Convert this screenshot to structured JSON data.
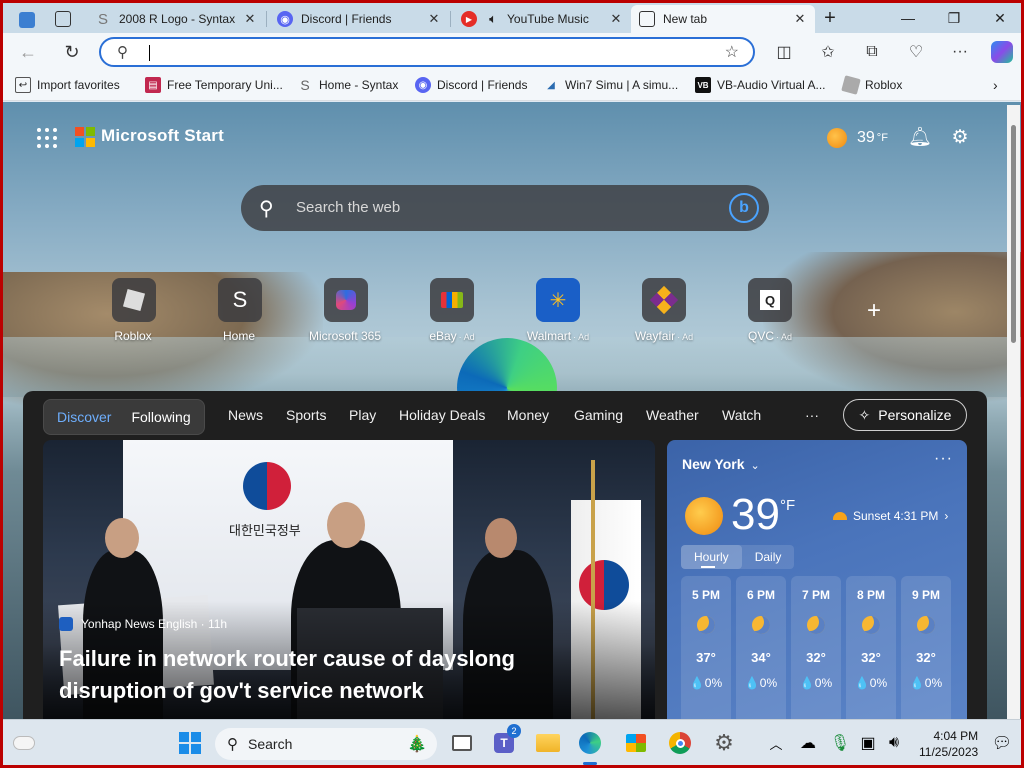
{
  "browser": {
    "tabs": [
      {
        "title": "2008 R Logo - Syntax"
      },
      {
        "title": "Discord | Friends"
      },
      {
        "title": "YouTube Music"
      },
      {
        "title": "New tab"
      }
    ],
    "address": {
      "value": ""
    },
    "favorites": [
      {
        "label": "Import favorites"
      },
      {
        "label": "Free Temporary Uni..."
      },
      {
        "label": "Home - Syntax"
      },
      {
        "label": "Discord | Friends"
      },
      {
        "label": "Win7 Simu | A simu..."
      },
      {
        "label": "VB-Audio Virtual A..."
      },
      {
        "label": "Roblox"
      }
    ]
  },
  "start": {
    "brand": "Microsoft Start",
    "weather_temp": "39",
    "weather_unit": "°F",
    "search_placeholder": "Search the web",
    "quicklinks": [
      {
        "label": "Roblox",
        "ad": ""
      },
      {
        "label": "Home",
        "ad": ""
      },
      {
        "label": "Microsoft 365",
        "ad": ""
      },
      {
        "label": "eBay",
        "ad": "· Ad"
      },
      {
        "label": "Walmart",
        "ad": "· Ad"
      },
      {
        "label": "Wayfair",
        "ad": "· Ad"
      },
      {
        "label": "QVC",
        "ad": "· Ad"
      }
    ],
    "feed_tabs": {
      "discover": "Discover",
      "following": "Following"
    },
    "nav": [
      "News",
      "Sports",
      "Play",
      "Holiday Deals",
      "Money",
      "Gaming",
      "Weather",
      "Watch",
      "···"
    ],
    "personalize": "Personalize",
    "hero": {
      "emblem_text": "대한민국정부",
      "source": "Yonhap News English · 11h",
      "headline": "Failure in network router cause of dayslong disruption of gov't service network"
    },
    "weather": {
      "city": "New York",
      "more": "···",
      "temp": "39",
      "unit": "°F",
      "sunset": "Sunset 4:31 PM",
      "tabs": [
        "Hourly",
        "Daily"
      ],
      "hours": [
        {
          "time": "5 PM",
          "temp": "37°",
          "precip": "💧0%"
        },
        {
          "time": "6 PM",
          "temp": "34°",
          "precip": "💧0%"
        },
        {
          "time": "7 PM",
          "temp": "32°",
          "precip": "💧0%"
        },
        {
          "time": "8 PM",
          "temp": "32°",
          "precip": "💧0%"
        },
        {
          "time": "9 PM",
          "temp": "32°",
          "precip": "💧0%"
        }
      ]
    }
  },
  "taskbar": {
    "search": "Search",
    "teams_badge": "2",
    "time": "4:04 PM",
    "date": "11/25/2023"
  },
  "colors": {
    "accent": "#2a6fd6",
    "tab_bar": "#c9dbe8",
    "feed_bg": "#1f1f1f",
    "weather_card": "#4a74bb"
  }
}
